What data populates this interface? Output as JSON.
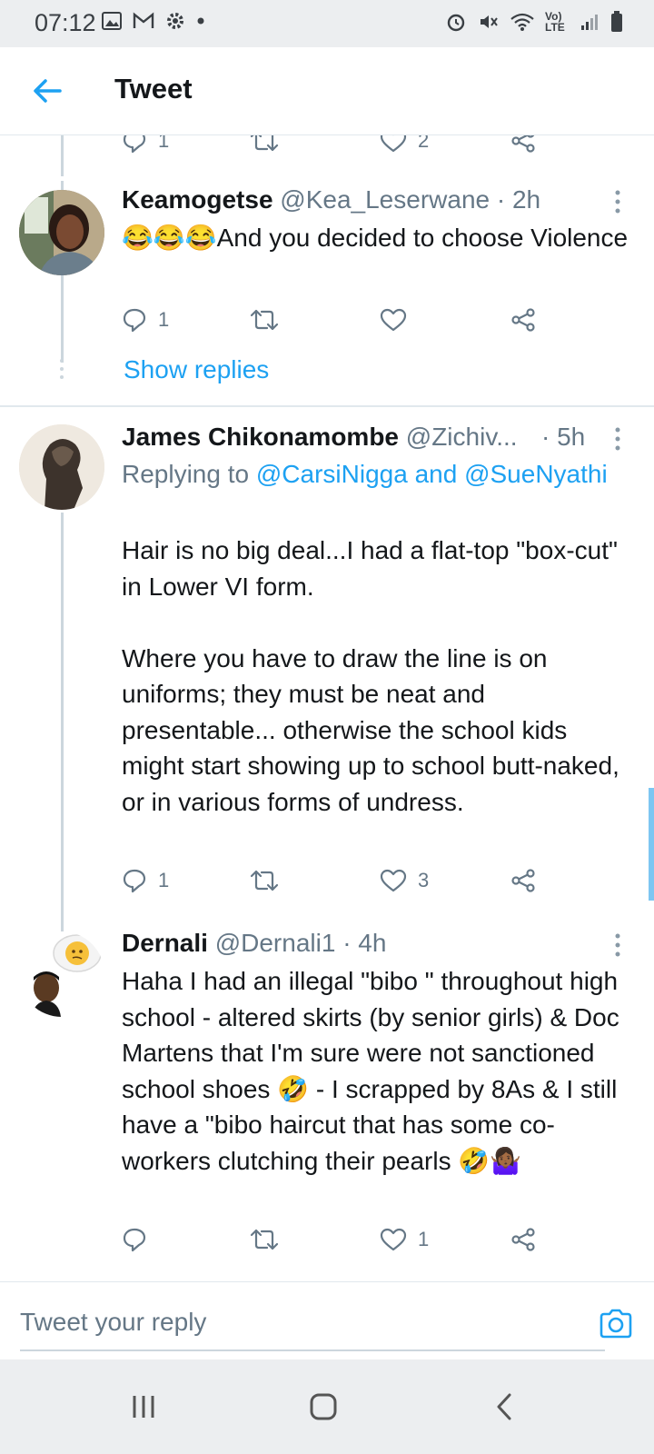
{
  "status_bar": {
    "time": "07:12",
    "network": "Vo) LTE"
  },
  "header": {
    "title": "Tweet"
  },
  "top_actions": {
    "reply_count": "1",
    "like_count": "2"
  },
  "tweets": [
    {
      "name": "Keamogetse",
      "handle": "@Kea_Leserwane",
      "time": "· 2h",
      "text": "😂😂😂And you decided to choose Violence",
      "reply_count": "1",
      "retweet_count": "",
      "like_count": "",
      "show_replies": "Show replies"
    },
    {
      "name": "James Chikonamombe",
      "handle": "@Zichiv...",
      "time": "· 5h",
      "replying_prefix": "Replying to",
      "replying_users": "@CarsiNigga and @SueNyathi",
      "text": "Hair is no big deal...I had a flat-top \"box-cut\" in Lower VI form.\n\nWhere you have to draw the line is on uniforms; they must be neat and presentable... otherwise the school kids might start showing up to school butt-naked, or in various forms of undress.",
      "reply_count": "1",
      "retweet_count": "",
      "like_count": "3"
    },
    {
      "name": "Dernali",
      "handle": "@Dernali1",
      "time": "· 4h",
      "text": "Haha I had an illegal \"bibo \" throughout high school - altered skirts (by senior girls) & Doc Martens that I'm sure were not sanctioned school shoes 🤣 - I scrapped by 8As & I still have a \"bibo haircut that has some co-workers clutching their pearls 🤣🤷🏾‍♀️",
      "reply_count": "",
      "retweet_count": "",
      "like_count": "1"
    }
  ],
  "composer": {
    "placeholder": "Tweet your reply"
  },
  "colors": {
    "accent": "#1da1f2",
    "muted": "#657786",
    "text": "#14171a",
    "border": "#e1e8ed"
  },
  "icons": [
    "back-arrow-icon",
    "reply-icon",
    "retweet-icon",
    "like-icon",
    "share-icon",
    "more-icon",
    "camera-icon",
    "recents-icon",
    "home-icon",
    "back-icon"
  ]
}
